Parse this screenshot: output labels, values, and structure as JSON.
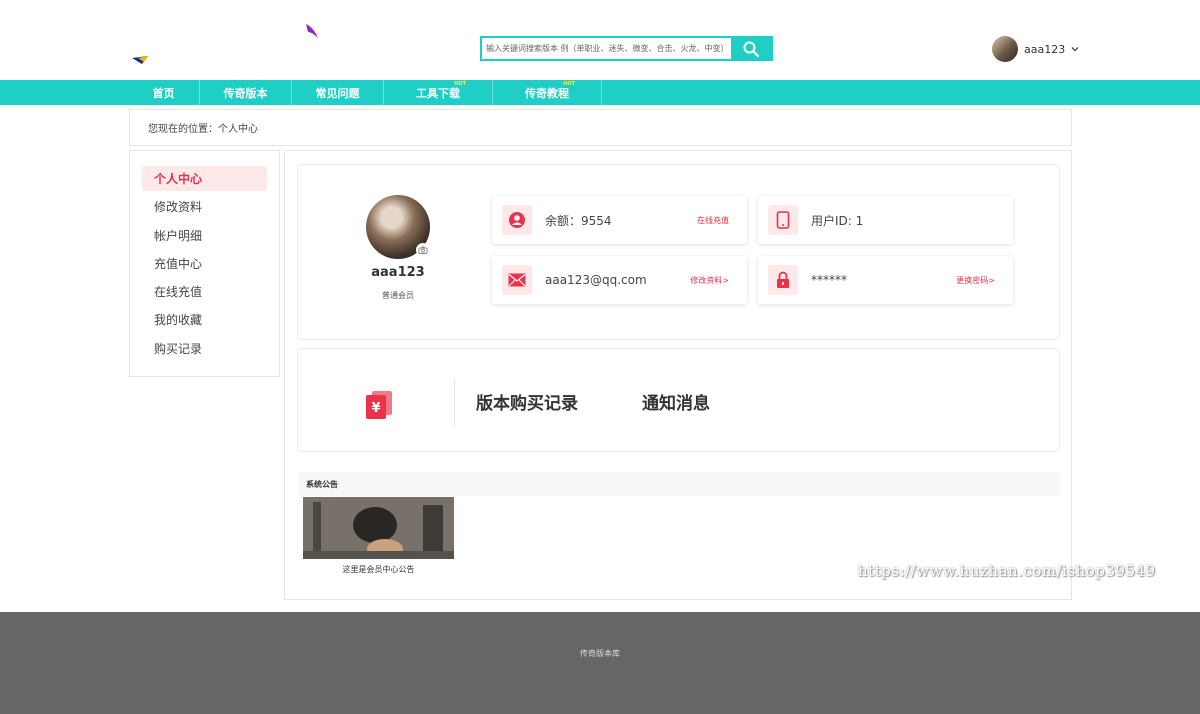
{
  "search": {
    "placeholder": "输入关键词搜索版本 例（单职业、迷失、微变、合击、火龙、中变）"
  },
  "user": {
    "name": "aaa123"
  },
  "nav": {
    "items": [
      {
        "label": "首页",
        "hot": ""
      },
      {
        "label": "传奇版本",
        "hot": ""
      },
      {
        "label": "常见问题",
        "hot": ""
      },
      {
        "label": "工具下载",
        "hot": "HOT"
      },
      {
        "label": "传奇教程",
        "hot": "HOT"
      }
    ]
  },
  "breadcrumb": {
    "text": "您现在的位置：个人中心"
  },
  "sidebar": {
    "items": [
      {
        "label": "个人中心",
        "active": true
      },
      {
        "label": "修改资料",
        "active": false
      },
      {
        "label": "帐户明细",
        "active": false
      },
      {
        "label": "充值中心",
        "active": false
      },
      {
        "label": "在线充值",
        "active": false
      },
      {
        "label": "我的收藏",
        "active": false
      },
      {
        "label": "购买记录",
        "active": false
      }
    ]
  },
  "profile": {
    "name": "aaa123",
    "level": "普通会员",
    "balance": "余额：9554",
    "recharge_link": "在线充值",
    "user_id": "用户ID: 1",
    "email": "aaa123@qq.com",
    "edit_link": "修改资料>",
    "password": "******",
    "password_link": "更换密码>"
  },
  "records": {
    "tab_purchase": "版本购买记录",
    "tab_notice": "通知消息"
  },
  "notice": {
    "title": "系统公告",
    "caption": "这里是会员中心公告"
  },
  "watermark": "https://www.huzhan.com/ishop39549",
  "footer": {
    "text": "传奇版本库"
  },
  "colors": {
    "accent": "#1fcfc6",
    "highlight": "#e8334a",
    "footer": "#666666"
  }
}
